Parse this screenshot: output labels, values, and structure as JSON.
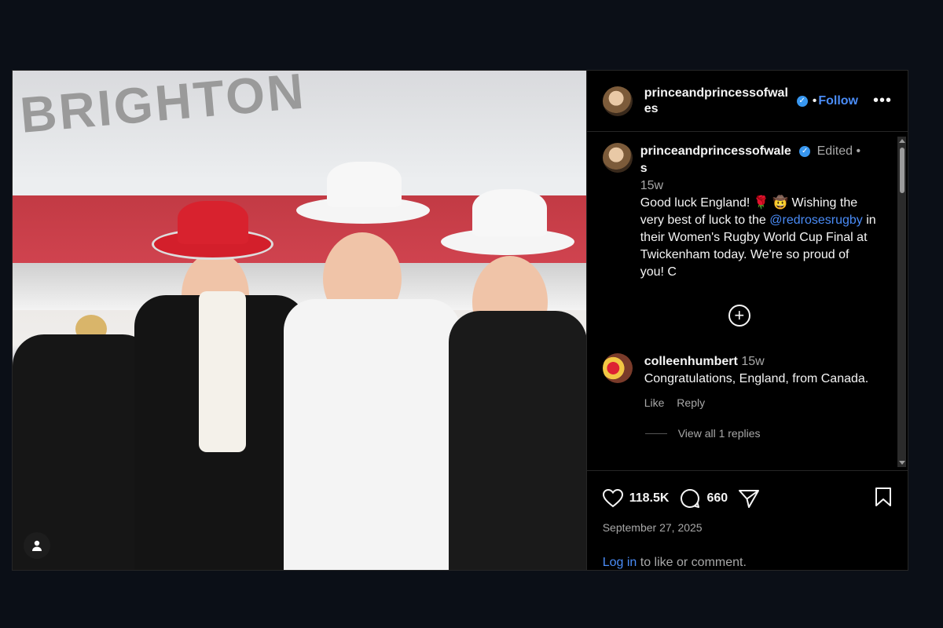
{
  "header": {
    "username": "princeandprincessofwales",
    "dot": "•",
    "follow_label": "Follow",
    "more_label": "•••"
  },
  "photo": {
    "wall_sign": "BRIGHTON",
    "profile_icon": "user-icon"
  },
  "caption": {
    "username": "princeandprincessofwales",
    "edited": "Edited",
    "dot": "•",
    "time": "15w",
    "text_before": "Good luck England! 🌹 🤠 Wishing the very best of luck to the ",
    "mention": "@redrosesrugby",
    "text_after": " in their Women's Rugby World Cup Final at Twickenham today. We're so proud of you! C"
  },
  "load_more_icon": "plus-circle-icon",
  "comment": {
    "username": "colleenhumbert",
    "time": "15w",
    "text": "Congratulations, England, from Canada.",
    "like_label": "Like",
    "reply_label": "Reply",
    "view_replies": "View all 1 replies"
  },
  "actions": {
    "likes": "118.5K",
    "comments": "660"
  },
  "date": "September 27, 2025",
  "login": {
    "link": "Log in",
    "text": " to like or comment."
  },
  "colors": {
    "background": "#0b0f17",
    "panel": "#000000",
    "link": "#4a8cf7",
    "verified": "#3897f0",
    "muted": "#a8a8a8"
  }
}
